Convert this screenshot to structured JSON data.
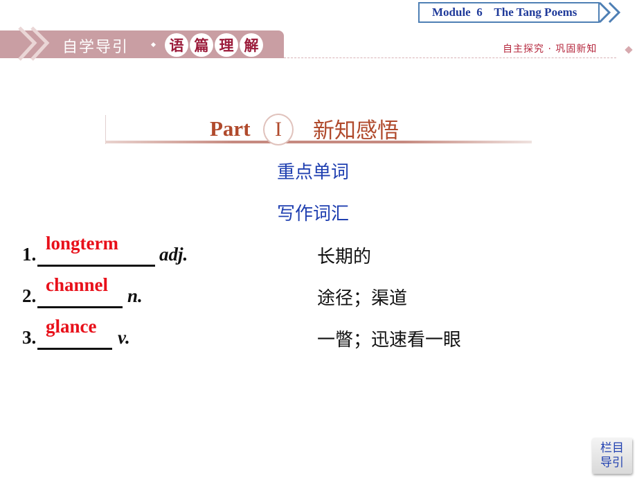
{
  "header": {
    "module_title": "Module  6    The Tang Poems",
    "section_prefix": "自学导引",
    "section_chars": [
      "语",
      "篇",
      "理",
      "解"
    ],
    "subtitle_right": "自主探究 · 巩固新知"
  },
  "part": {
    "label": "Part",
    "numeral": "I",
    "title_cn": "新知感悟"
  },
  "headings": {
    "primary": "重点单词",
    "secondary": "写作词汇"
  },
  "vocabulary": [
    {
      "number": "1.",
      "answer": "longterm",
      "pos": "adj.",
      "meaning": "长期的"
    },
    {
      "number": "2.",
      "answer": "channel",
      "pos": "n.",
      "meaning": "途径；渠道"
    },
    {
      "number": "3.",
      "answer": "glance",
      "pos": "v.",
      "meaning": "一瞥；迅速看一眼"
    }
  ],
  "nav_button": {
    "line1": "栏目",
    "line2": "导引"
  },
  "colors": {
    "band": "#c99ea3",
    "answer_red": "#e8101a",
    "heading_blue": "#1f3fb0",
    "part_brown": "#b04a2c"
  }
}
